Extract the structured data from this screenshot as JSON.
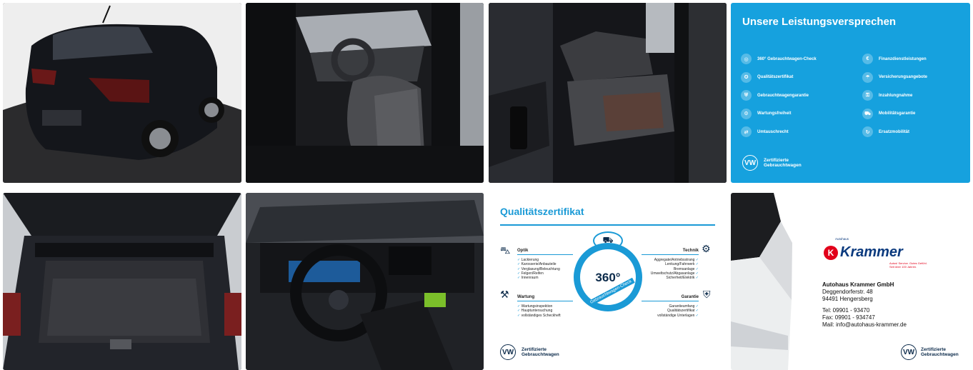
{
  "gallery": {
    "photos": [
      {
        "name": "car-rear-exterior"
      },
      {
        "name": "front-interior-driver-seat"
      },
      {
        "name": "rear-seats"
      },
      {
        "name": "trunk-open"
      },
      {
        "name": "dashboard-steering-wheel"
      },
      {
        "name": "dealer-card-car-edge"
      }
    ],
    "promise_card": {
      "title": "Unsere Leistungsversprechen",
      "left_items": [
        "360° Gebrauchtwagen-Check",
        "Qualitätszertifikat",
        "Gebrauchtwagengarantie",
        "Wartungsfreiheit",
        "Umtauschrecht"
      ],
      "right_items": [
        "Finanzdienstleistungen",
        "Versicherungsangebote",
        "Inzahlungnahme",
        "Mobilitätsgarantie",
        "Ersatzmobilität"
      ],
      "footer_line1": "Zertifizierte",
      "footer_line2": "Gebrauchtwagen",
      "logo": "VW"
    },
    "certificate_card": {
      "title": "Qualitätszertifikat",
      "center_number": "360°",
      "center_arc": "Gebrauchtwagen-Check",
      "optik": {
        "head": "Optik",
        "items": [
          "Lackierung",
          "Karosserie/Anbauteile",
          "Verglasung/Beleuchtung",
          "Felgen/Reifen",
          "Innenraum"
        ]
      },
      "technik": {
        "head": "Technik",
        "items": [
          "Aggregate/Antriebsstrang",
          "Lenkung/Fahrwerk",
          "Bremsanlage",
          "Umweltschutz/Abgasanlage",
          "Sicherheit/Elektrik"
        ]
      },
      "wartung": {
        "head": "Wartung",
        "items": [
          "Wartungsinspektion",
          "Hauptuntersuchung",
          "vollständiges Scheckheft"
        ]
      },
      "garantie": {
        "head": "Garantie",
        "items": [
          "Garantieumfang",
          "Qualitätszertifikat",
          "vollständige Unterlagen"
        ]
      },
      "footer_line1": "Zertifizierte",
      "footer_line2": "Gebrauchtwagen",
      "logo": "VW"
    },
    "dealer_card": {
      "logo_small": "Autohaus",
      "logo_letter": "K",
      "logo_name": "Krammer",
      "tagline_line1": "Autos! Service. Gutes Gefühl.",
      "tagline_line2": "Seit über 100 Jahren.",
      "company": "Autohaus Krammer GmbH",
      "street": "Deggendorferstr. 48",
      "city": "94491 Hengersberg",
      "tel": "Tel: 09901 - 93470",
      "fax": "Fax: 09901 - 934747",
      "mail": "Mail: info@autohaus-krammer.de",
      "footer_line1": "Zertifizierte",
      "footer_line2": "Gebrauchtwagen",
      "logo": "VW"
    }
  },
  "colors": {
    "brand_blue": "#16a1de",
    "dark_navy": "#0b2a4a",
    "krammer_red": "#e2001a",
    "krammer_blue": "#0b3a7e"
  }
}
